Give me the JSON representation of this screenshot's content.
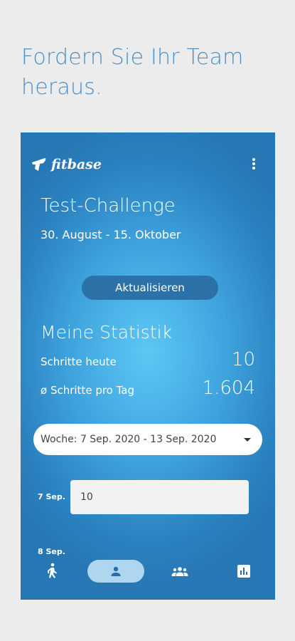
{
  "headline": "Fordern Sie Ihr Team heraus.",
  "app": {
    "brand": "fitbase",
    "challenge_title": "Test-Challenge",
    "challenge_dates": "30. August - 15. Oktober",
    "refresh_label": "Aktualisieren"
  },
  "stats": {
    "title": "Meine Statistik",
    "steps_today_label": "Schritte heute",
    "steps_today_value": "10",
    "avg_steps_label": "ø Schritte pro Tag",
    "avg_steps_value": "1.604"
  },
  "week_select": {
    "value": "Woche: 7 Sep. 2020 - 13 Sep. 2020"
  },
  "days": [
    {
      "label": "7 Sep.",
      "value": "10"
    },
    {
      "label": "8 Sep."
    }
  ],
  "bottom_nav": [
    {
      "icon": "walk-icon",
      "active": false
    },
    {
      "icon": "person-icon",
      "active": true
    },
    {
      "icon": "group-icon",
      "active": false
    },
    {
      "icon": "chart-icon",
      "active": false
    }
  ],
  "colors": {
    "headline": "#4b8fc4",
    "screen_dark": "#2777b4",
    "screen_light": "#5cc8f5",
    "button": "#2c72a8",
    "nav_active": "#aed6ef"
  }
}
